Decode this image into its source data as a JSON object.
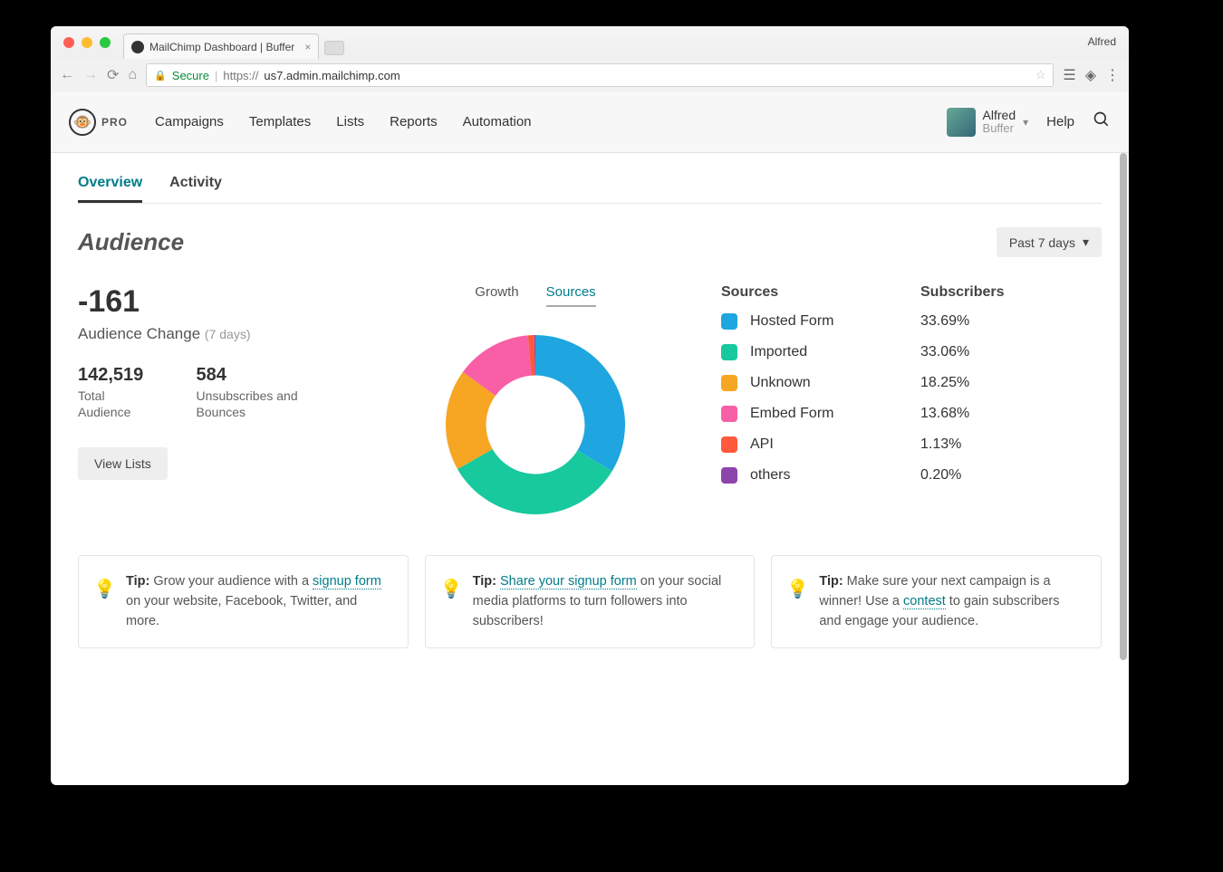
{
  "browser": {
    "tab_title": "MailChimp Dashboard | Buffer",
    "profile_name": "Alfred",
    "secure_label": "Secure",
    "url_prefix": "https://",
    "url_host": "us7.admin.mailchimp.com"
  },
  "header": {
    "pro_label": "PRO",
    "nav": [
      "Campaigns",
      "Templates",
      "Lists",
      "Reports",
      "Automation"
    ],
    "user_name": "Alfred",
    "user_org": "Buffer",
    "help_label": "Help"
  },
  "tabs": {
    "overview": "Overview",
    "activity": "Activity",
    "active": "overview"
  },
  "section": {
    "title": "Audience",
    "range_label": "Past 7 days"
  },
  "stats": {
    "change_value": "-161",
    "change_label": "Audience Change",
    "change_window": "(7 days)",
    "total_value": "142,519",
    "total_label": "Total Audience",
    "unsub_value": "584",
    "unsub_label": "Unsubscribes and Bounces",
    "view_lists": "View Lists"
  },
  "chart_tabs": {
    "growth": "Growth",
    "sources": "Sources",
    "active": "sources"
  },
  "legend": {
    "head_sources": "Sources",
    "head_subs": "Subscribers",
    "rows": [
      {
        "name": "Hosted Form",
        "pct": "33.69%",
        "color": "#1fa6e0"
      },
      {
        "name": "Imported",
        "pct": "33.06%",
        "color": "#18c99d"
      },
      {
        "name": "Unknown",
        "pct": "18.25%",
        "color": "#f6a623"
      },
      {
        "name": "Embed Form",
        "pct": "13.68%",
        "color": "#f85fa6"
      },
      {
        "name": "API",
        "pct": "1.13%",
        "color": "#ff5a3c"
      },
      {
        "name": "others",
        "pct": "0.20%",
        "color": "#8e44ad"
      }
    ]
  },
  "tips": [
    {
      "bold": "Tip:",
      "pre": " Grow your audience with a ",
      "link": "signup form",
      "post": " on your website, Facebook, Twitter, and more."
    },
    {
      "bold": "Tip:",
      "pre": " ",
      "link": "Share your signup form",
      "post": " on your social media platforms to turn followers into subscribers!"
    },
    {
      "bold": "Tip:",
      "pre": " Make sure your next campaign is a winner! Use a ",
      "link": "contest",
      "post": " to gain subscribers and engage your audience."
    }
  ],
  "chart_data": {
    "type": "pie",
    "title": "Sources",
    "series": [
      {
        "name": "Hosted Form",
        "value": 33.69,
        "color": "#1fa6e0"
      },
      {
        "name": "Imported",
        "value": 33.06,
        "color": "#18c99d"
      },
      {
        "name": "Unknown",
        "value": 18.25,
        "color": "#f6a623"
      },
      {
        "name": "Embed Form",
        "value": 13.68,
        "color": "#f85fa6"
      },
      {
        "name": "API",
        "value": 1.13,
        "color": "#ff5a3c"
      },
      {
        "name": "others",
        "value": 0.2,
        "color": "#8e44ad"
      }
    ],
    "donut_inner_ratio": 0.55
  }
}
